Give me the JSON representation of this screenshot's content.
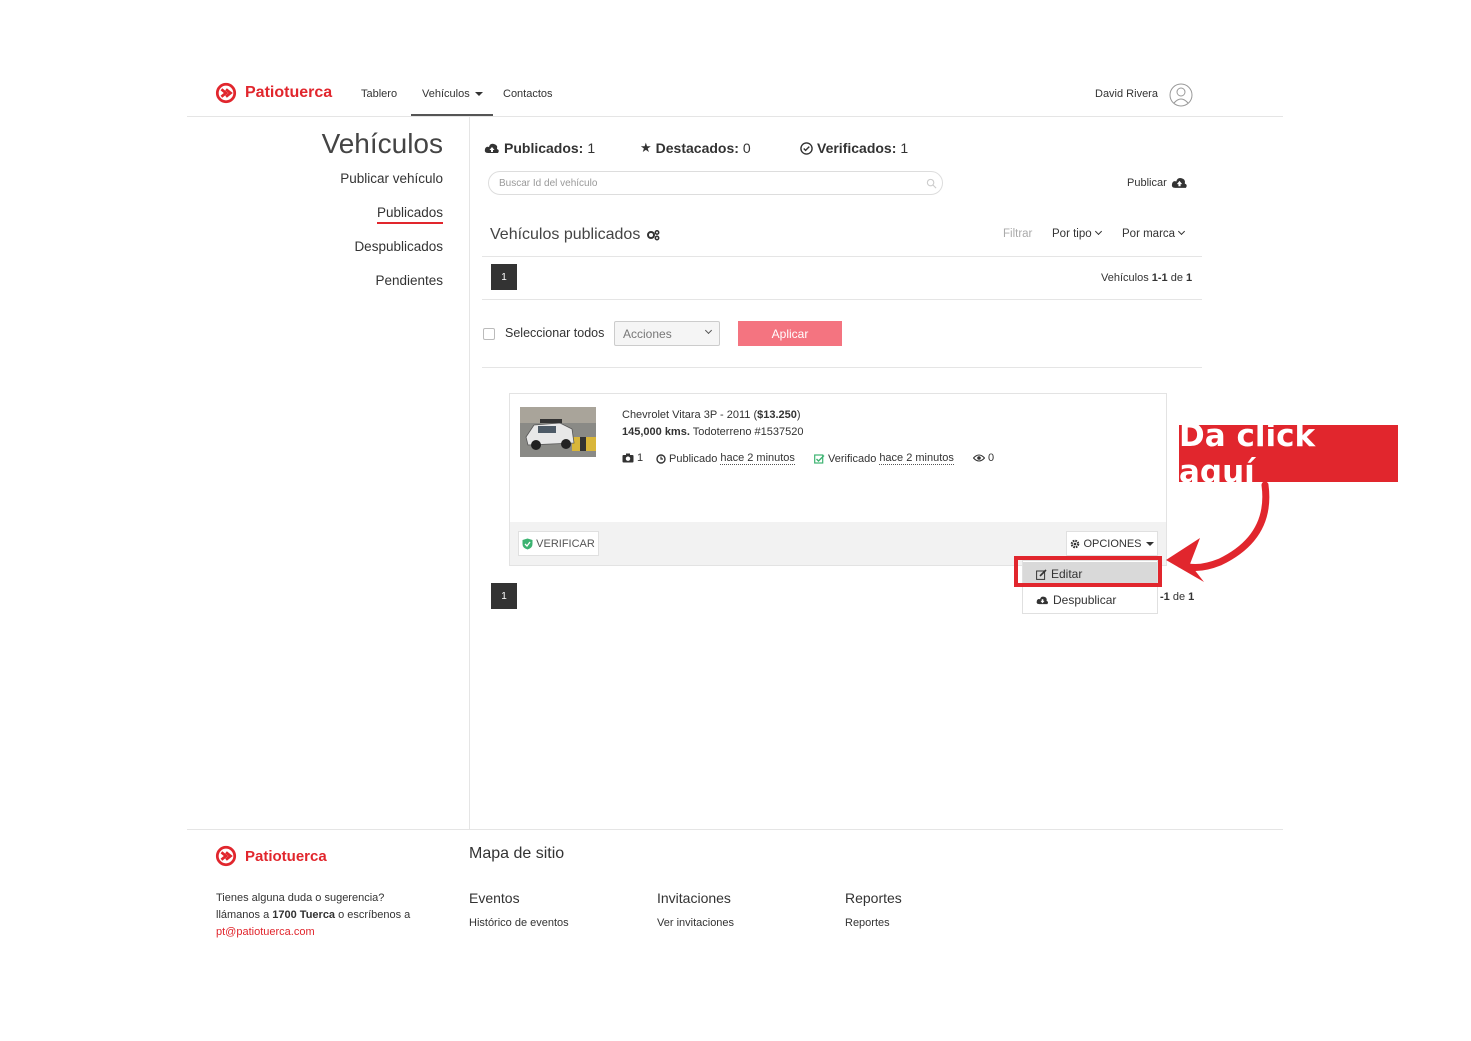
{
  "header": {
    "brand": "Patiotuerca",
    "nav": [
      {
        "label": "Tablero"
      },
      {
        "label": "Vehículos"
      },
      {
        "label": "Contactos"
      }
    ],
    "user_name": "David Rivera"
  },
  "sidebar": {
    "title": "Vehículos",
    "items": [
      {
        "label": "Publicar vehículo"
      },
      {
        "label": "Publicados"
      },
      {
        "label": "Despublicados"
      },
      {
        "label": "Pendientes"
      }
    ]
  },
  "stats": {
    "published_label": "Publicados:",
    "published_value": "1",
    "featured_label": "Destacados:",
    "featured_value": "0",
    "verified_label": "Verificados:",
    "verified_value": "1"
  },
  "search": {
    "placeholder": "Buscar Id del vehículo"
  },
  "publish_label": "Publicar",
  "section": {
    "title": "Vehículos publicados",
    "filter_label": "Filtrar",
    "filter_type": "Por tipo",
    "filter_brand": "Por marca"
  },
  "pagination": {
    "page": "1",
    "count_prefix": "Vehículos",
    "count_range": "1-1",
    "count_of": "de",
    "count_total": "1",
    "bottom_suffix": "-1",
    "bottom_of": "de",
    "bottom_total": "1"
  },
  "bulk": {
    "select_all": "Seleccionar todos",
    "actions": "Acciones",
    "apply": "Aplicar"
  },
  "vehicle": {
    "title_prefix": "Chevrolet Vitara 3P - 2011 (",
    "price": "$13.250",
    "title_suffix": ")",
    "km": "145,000 kms.",
    "subtitle": "Todoterreno #1537520",
    "photos": "1",
    "published_label": "Publicado",
    "published_time": "hace 2 minutos",
    "verified_label": "Verificado",
    "verified_time": "hace 2 minutos",
    "views": "0",
    "verify_button": "VERIFICAR",
    "options_button": "OPCIONES",
    "menu": [
      {
        "label": "Editar"
      },
      {
        "label": "Despublicar"
      }
    ]
  },
  "callout": "Da click aquí",
  "footer": {
    "brand": "Patiotuerca",
    "sitemap_title": "Mapa de sitio",
    "contact_line1": "Tienes alguna duda o sugerencia?",
    "contact_line2_a": "llámanos a ",
    "contact_phone": "1700 Tuerca",
    "contact_line2_b": " o escríbenos a",
    "contact_email": "pt@patiotuerca.com",
    "columns": [
      {
        "heading": "Eventos",
        "link": "Histórico de eventos"
      },
      {
        "heading": "Invitaciones",
        "link": "Ver invitaciones"
      },
      {
        "heading": "Reportes",
        "link": "Reportes"
      }
    ]
  },
  "colors": {
    "brand": "#e1262d",
    "apply": "#f47480",
    "verified": "#3cb371"
  }
}
